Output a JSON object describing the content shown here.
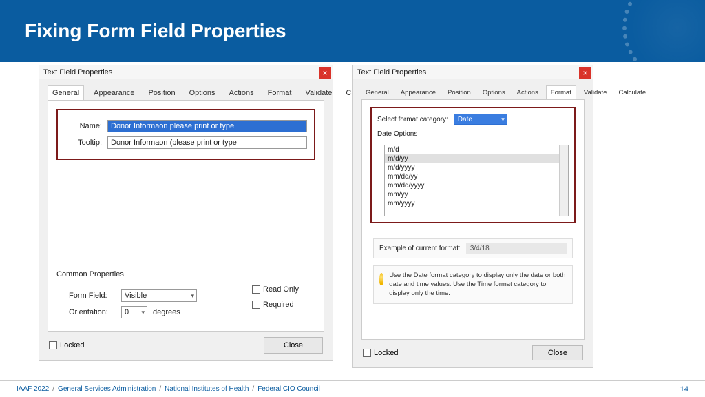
{
  "banner": {
    "title": "Fixing Form Field Properties"
  },
  "leftDialog": {
    "title": "Text Field Properties",
    "tabs": {
      "general": "General",
      "appearance": "Appearance",
      "position": "Position",
      "options": "Options",
      "actions": "Actions",
      "format": "Format",
      "validate": "Validate",
      "calculate_trunc": "Ca"
    },
    "nameLabel": "Name:",
    "nameValue": "Donor Informaon please print or type",
    "tooltipLabel": "Tooltip:",
    "tooltipValue": "Donor Informaon (please print or type",
    "commonHeading": "Common Properties",
    "formFieldLabel": "Form Field:",
    "formFieldValue": "Visible",
    "orientationLabel": "Orientation:",
    "orientationValue": "0",
    "degrees": "degrees",
    "readOnlyLabel": "Read Only",
    "requiredLabel": "Required",
    "lockedLabel": "Locked",
    "closeLabel": "Close"
  },
  "rightDialog": {
    "title": "Text Field Properties",
    "tabs": {
      "general": "General",
      "appearance": "Appearance",
      "position": "Position",
      "options": "Options",
      "actions": "Actions",
      "format": "Format",
      "validate": "Validate",
      "calculate": "Calculate"
    },
    "selectFormatLabel": "Select format category:",
    "selectFormatValue": "Date",
    "dateOptionsLabel": "Date Options",
    "dateOptions": [
      "m/d",
      "m/d/yy",
      "m/d/yyyy",
      "mm/dd/yy",
      "mm/dd/yyyy",
      "mm/yy",
      "mm/yyyy"
    ],
    "selectedDateOption": "m/d/yy",
    "exampleLabel": "Example of current format:",
    "exampleValue": "3/4/18",
    "tip": "Use the Date format category to display only the date or both date and time values. Use the Time format category to display only the time.",
    "lockedLabel": "Locked",
    "closeLabel": "Close"
  },
  "footer": {
    "parts": [
      "IAAF 2022",
      "General Services Administration",
      "National Institutes of Health",
      "Federal CIO Council"
    ],
    "page": "14"
  }
}
